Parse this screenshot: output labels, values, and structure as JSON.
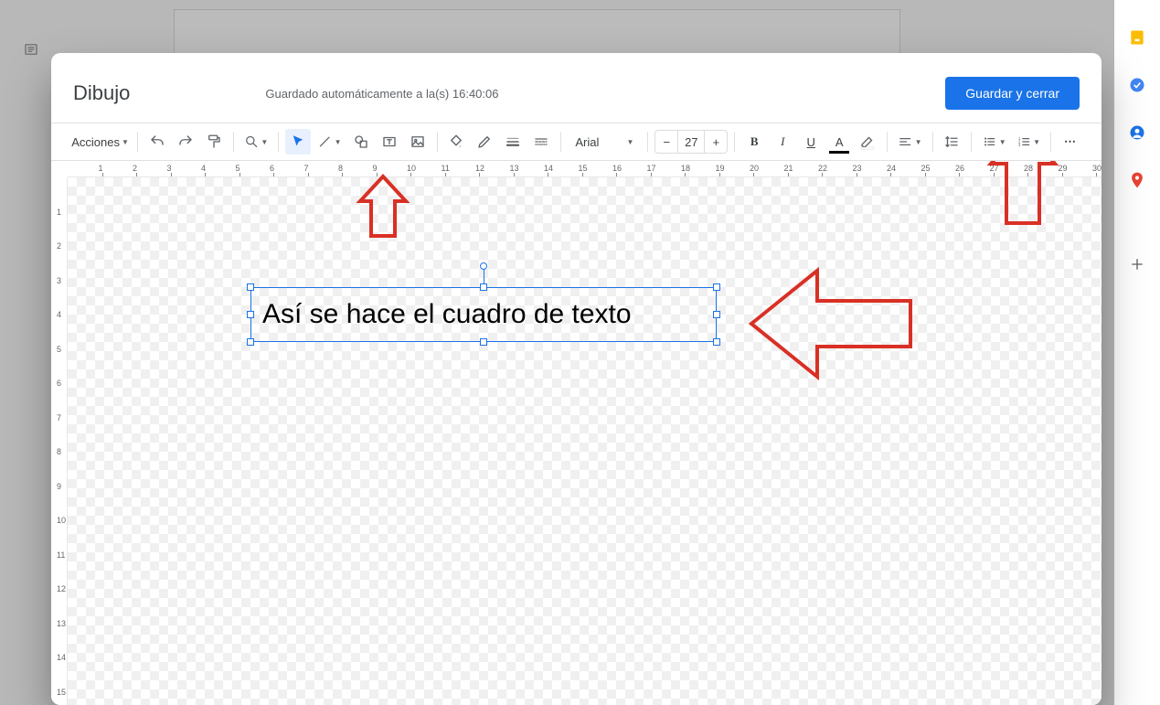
{
  "modal": {
    "title": "Dibujo",
    "status": "Guardado automáticamente a la(s) 16:40:06",
    "save_button": "Guardar y cerrar"
  },
  "toolbar": {
    "actions_label": "Acciones",
    "font_name": "Arial",
    "font_size": "27",
    "bold": "B",
    "italic": "I",
    "underline": "U",
    "text_color": "A",
    "more": "⋯"
  },
  "canvas": {
    "textbox_content": "Así se hace el cuadro de texto"
  },
  "ruler": {
    "h_labels": [
      "1",
      "2",
      "3",
      "4",
      "5",
      "6",
      "7",
      "8",
      "9",
      "10",
      "11",
      "12",
      "13",
      "14",
      "15",
      "16",
      "17",
      "18",
      "19",
      "20",
      "21",
      "22",
      "23",
      "24",
      "25",
      "26",
      "27",
      "28",
      "29",
      "30"
    ],
    "v_labels": [
      "1",
      "2",
      "3",
      "4",
      "5",
      "6",
      "7",
      "8",
      "9",
      "10",
      "11",
      "12",
      "13",
      "14",
      "15"
    ]
  },
  "side_icons": [
    "keep",
    "tasks",
    "contacts",
    "maps"
  ]
}
